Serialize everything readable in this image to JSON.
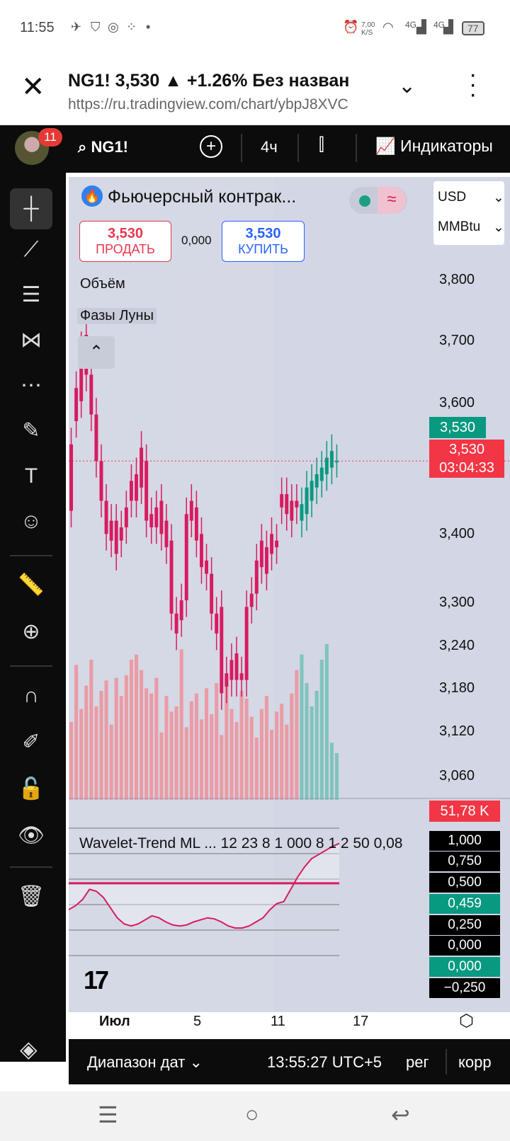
{
  "status_bar": {
    "time": "11:55",
    "speed": "7,00 K/S",
    "net1": "4G",
    "net2": "4G",
    "battery": "77"
  },
  "browser": {
    "close_icon": "close-icon",
    "title": "NG1! 3,530 ▲ +1.26% Без назван",
    "url": "https://ru.tradingview.com/chart/ybpJ8XVC"
  },
  "app": {
    "notif_count": "11",
    "symbol": "NG1!",
    "interval": "4ч",
    "indicators_label": "Индикаторы"
  },
  "legend": {
    "name": "Фьючерсный контрак...",
    "sell_price": "3,530",
    "sell_label": "ПРОДАТЬ",
    "spread": "0,000",
    "buy_price": "3,530",
    "buy_label": "КУПИТЬ",
    "volume_label": "Объём",
    "moon_label": "Фазы Луны"
  },
  "currency": {
    "currency": "USD",
    "unit": "MMBtu"
  },
  "price_axis": [
    "3,800",
    "3,700",
    "3,600",
    "3,400",
    "3,300",
    "3,240",
    "3,180",
    "3,120",
    "3,060"
  ],
  "price_tags": {
    "last_green": "3,530",
    "last_red": "3,530",
    "countdown": "03:04:33",
    "volume": "51,78 K"
  },
  "oscillator": {
    "title": "Wavelet-Trend ML ... 12 23 8 1 000 8 1 2 50 0,08",
    "axis": [
      "1,000",
      "0,750",
      "0,500",
      "0,459",
      "0,250",
      "0,000",
      "0,000",
      "−0,250"
    ]
  },
  "x_axis": {
    "labels": [
      "Июл",
      "5",
      "11",
      "17"
    ]
  },
  "bottom": {
    "range": "Диапазон дат",
    "time": "13:55:27 UTC+5",
    "reg": "рег",
    "corr": "корр"
  },
  "colors": {
    "up": "#089981",
    "down": "#d81b60",
    "bg": "#d3d6e4",
    "toolbar": "#0c0c0c"
  },
  "chart_data": {
    "type": "candlestick",
    "candles": [
      {
        "o": 3555,
        "c": 3455
      },
      {
        "o": 3640,
        "c": 3590
      },
      {
        "o": 3700,
        "c": 3620
      },
      {
        "o": 3720,
        "c": 3660
      },
      {
        "o": 3660,
        "c": 3600
      },
      {
        "o": 3600,
        "c": 3530
      },
      {
        "o": 3530,
        "c": 3470
      },
      {
        "o": 3470,
        "c": 3420
      },
      {
        "o": 3440,
        "c": 3410
      },
      {
        "o": 3440,
        "c": 3390
      },
      {
        "o": 3430,
        "c": 3410
      },
      {
        "o": 3460,
        "c": 3430
      },
      {
        "o": 3500,
        "c": 3470
      },
      {
        "o": 3510,
        "c": 3470
      },
      {
        "o": 3550,
        "c": 3490
      },
      {
        "o": 3530,
        "c": 3440
      },
      {
        "o": 3450,
        "c": 3430
      },
      {
        "o": 3460,
        "c": 3430
      },
      {
        "o": 3470,
        "c": 3420
      },
      {
        "o": 3440,
        "c": 3400
      },
      {
        "o": 3410,
        "c": 3300
      },
      {
        "o": 3300,
        "c": 3270
      },
      {
        "o": 3320,
        "c": 3290
      },
      {
        "o": 3450,
        "c": 3320
      },
      {
        "o": 3470,
        "c": 3440
      },
      {
        "o": 3460,
        "c": 3410
      },
      {
        "o": 3420,
        "c": 3370
      },
      {
        "o": 3380,
        "c": 3360
      },
      {
        "o": 3360,
        "c": 3300
      },
      {
        "o": 3300,
        "c": 3270
      },
      {
        "o": 3310,
        "c": 3180
      },
      {
        "o": 3210,
        "c": 3190
      },
      {
        "o": 3230,
        "c": 3200
      },
      {
        "o": 3240,
        "c": 3200
      },
      {
        "o": 3210,
        "c": 3200
      },
      {
        "o": 3310,
        "c": 3200
      },
      {
        "o": 3330,
        "c": 3310
      },
      {
        "o": 3380,
        "c": 3330
      },
      {
        "o": 3410,
        "c": 3370
      },
      {
        "o": 3400,
        "c": 3360
      },
      {
        "o": 3420,
        "c": 3390
      },
      {
        "o": 3410,
        "c": 3400
      },
      {
        "o": 3480,
        "c": 3460
      },
      {
        "o": 3480,
        "c": 3450
      },
      {
        "o": 3470,
        "c": 3440
      },
      {
        "o": 3470,
        "c": 3460
      },
      {
        "o": 3440,
        "c": 3465
      },
      {
        "o": 3450,
        "c": 3490
      },
      {
        "o": 3470,
        "c": 3500
      },
      {
        "o": 3490,
        "c": 3510
      },
      {
        "o": 3500,
        "c": 3520
      },
      {
        "o": 3510,
        "c": 3535
      },
      {
        "o": 3520,
        "c": 3545
      },
      {
        "o": 3530,
        "c": 3530
      }
    ],
    "volumes": [
      30,
      52,
      35,
      44,
      54,
      36,
      42,
      46,
      29,
      47,
      40,
      48,
      54,
      56,
      50,
      43,
      41,
      47,
      26,
      40,
      34,
      36,
      58,
      28,
      38,
      41,
      31,
      43,
      33,
      45,
      25,
      48,
      35,
      30,
      42,
      39,
      32,
      24,
      35,
      40,
      27,
      34,
      37,
      29,
      41,
      50,
      56,
      45,
      36,
      42,
      54,
      60,
      22,
      18
    ],
    "oscillator_values": [
      0.2,
      0.24,
      0.3,
      0.4,
      0.38,
      0.32,
      0.22,
      0.12,
      0.06,
      0.04,
      0.06,
      0.1,
      0.14,
      0.12,
      0.08,
      0.05,
      0.04,
      0.05,
      0.08,
      0.1,
      0.12,
      0.11,
      0.08,
      0.04,
      0.02,
      0.02,
      0.04,
      0.08,
      0.12,
      0.2,
      0.26,
      0.28,
      0.4,
      0.52,
      0.62,
      0.7,
      0.74,
      0.78,
      0.82,
      0.85
    ],
    "oscillator_line": 0.459,
    "ylim": [
      3030,
      3830
    ]
  }
}
